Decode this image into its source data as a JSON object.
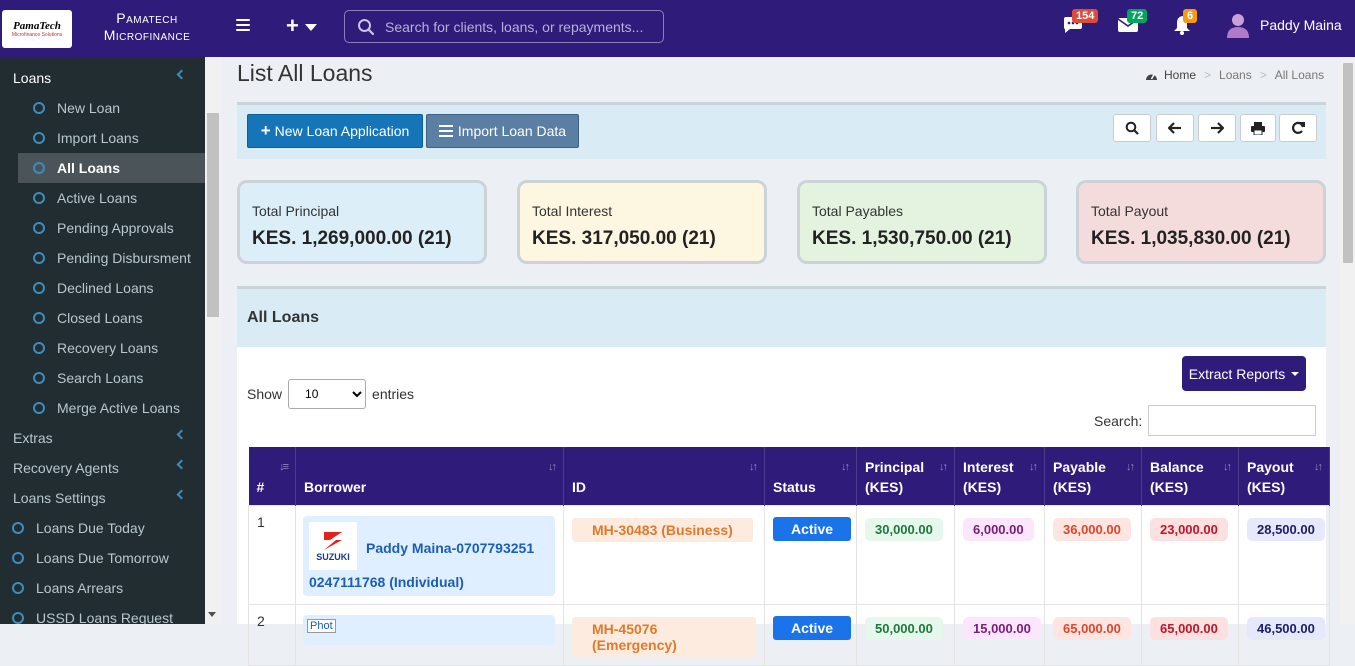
{
  "header": {
    "logo_text": "PamaTech",
    "logo_sub": "Microfinance Solutions",
    "brand_line1": "Pamatech",
    "brand_line2": "Microfinance",
    "search_placeholder": "Search for clients, loans, or repayments...",
    "messages_badge": "154",
    "mail_badge": "72",
    "notifications_badge": "6",
    "user_name": "Paddy Maina"
  },
  "sidebar": {
    "loans_label": "Loans",
    "loan_items": [
      "New Loan",
      "Import Loans",
      "All Loans",
      "Active Loans",
      "Pending Approvals",
      "Pending Disbursment",
      "Declined Loans",
      "Closed Loans",
      "Recovery Loans",
      "Search Loans",
      "Merge Active Loans"
    ],
    "active_item": "All Loans",
    "sections": [
      "Extras",
      "Recovery Agents",
      "Loans Settings"
    ],
    "bottom_items": [
      "Loans Due Today",
      "Loans Due Tomorrow",
      "Loans Arrears",
      "USSD Loans Request"
    ]
  },
  "page": {
    "title": "List All Loans",
    "breadcrumb": [
      "Home",
      "Loans",
      "All Loans"
    ]
  },
  "toolbar": {
    "new_loan_label": "New Loan Application",
    "import_label": "Import Loan Data",
    "tool_icons": [
      "search-icon",
      "arrow-left-icon",
      "arrow-right-icon",
      "print-icon",
      "refresh-icon"
    ]
  },
  "stats": [
    {
      "label": "Total Principal",
      "value": "KES. 1,269,000.00 (21)",
      "bg": "#dceef8"
    },
    {
      "label": "Total Interest",
      "value": "KES. 317,050.00 (21)",
      "bg": "#fdf6e0"
    },
    {
      "label": "Total Payables",
      "value": "KES. 1,530,750.00 (21)",
      "bg": "#e3f3e0"
    },
    {
      "label": "Total Payout",
      "value": "KES. 1,035,830.00 (21)",
      "bg": "#f4dcdc"
    }
  ],
  "table_panel": {
    "title": "All Loans",
    "extract_label": "Extract Reports",
    "show_label": "Show",
    "entries_label": "entries",
    "entries_value": "10",
    "search_label": "Search:"
  },
  "table": {
    "headers": [
      {
        "l1": "",
        "l2": "#"
      },
      {
        "l1": "",
        "l2": "Borrower"
      },
      {
        "l1": "",
        "l2": "ID"
      },
      {
        "l1": "",
        "l2": "Status"
      },
      {
        "l1": "Principal",
        "l2": "(KES)"
      },
      {
        "l1": "Interest",
        "l2": "(KES)"
      },
      {
        "l1": "Payable",
        "l2": "(KES)"
      },
      {
        "l1": "Balance",
        "l2": "(KES)"
      },
      {
        "l1": "Payout",
        "l2": "(KES)"
      }
    ],
    "rows": [
      {
        "num": "1",
        "borrower_name": "Paddy Maina-0707793251",
        "borrower_phone": "0247111768 (Individual)",
        "logo_text": "SUZUKI",
        "id": "MH-30483 (Business)",
        "status": "Active",
        "principal": "30,000.00",
        "interest": "6,000.00",
        "payable": "36,000.00",
        "balance": "23,000.00",
        "payout": "28,500.00"
      },
      {
        "num": "2",
        "borrower_name": "",
        "borrower_phone": "",
        "logo_text": "Phot",
        "id": "MH-45076 (Emergency)",
        "status": "Active",
        "principal": "50,000.00",
        "interest": "15,000.00",
        "payable": "65,000.00",
        "balance": "65,000.00",
        "payout": "46,500.00"
      }
    ]
  },
  "colors": {
    "topbar": "#2f1c7a",
    "sidebar": "#222d32",
    "primary_btn": "#1575b8",
    "active_status": "#1a73e8"
  }
}
